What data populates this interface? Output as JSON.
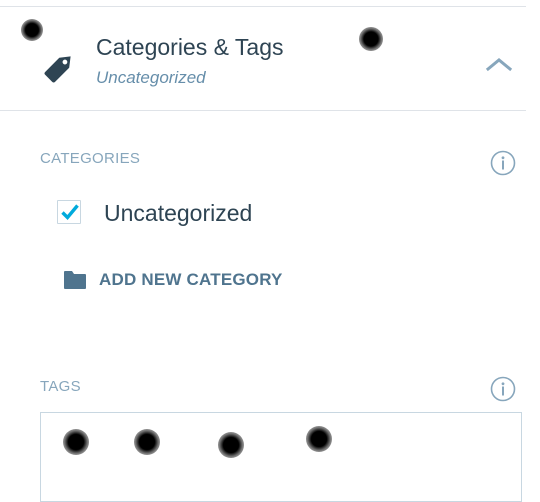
{
  "header": {
    "icon": "tag-icon",
    "title": "Categories & Tags",
    "subtitle": "Uncategorized",
    "collapse_icon": "chevron-up-icon"
  },
  "categories": {
    "label": "CATEGORIES",
    "info_icon": "info-icon",
    "items": [
      {
        "label": "Uncategorized",
        "checked": true
      }
    ],
    "add_new": {
      "icon": "folder-icon",
      "label": "ADD NEW CATEGORY"
    }
  },
  "tags": {
    "label": "TAGS",
    "info_icon": "info-icon",
    "input_value": ""
  },
  "colors": {
    "text_primary": "#2e4453",
    "text_muted": "#87a6bc",
    "subtitle": "#668eaa",
    "checkmark": "#00aadc",
    "folder": "#4f748e",
    "border": "#c8d7e1"
  }
}
